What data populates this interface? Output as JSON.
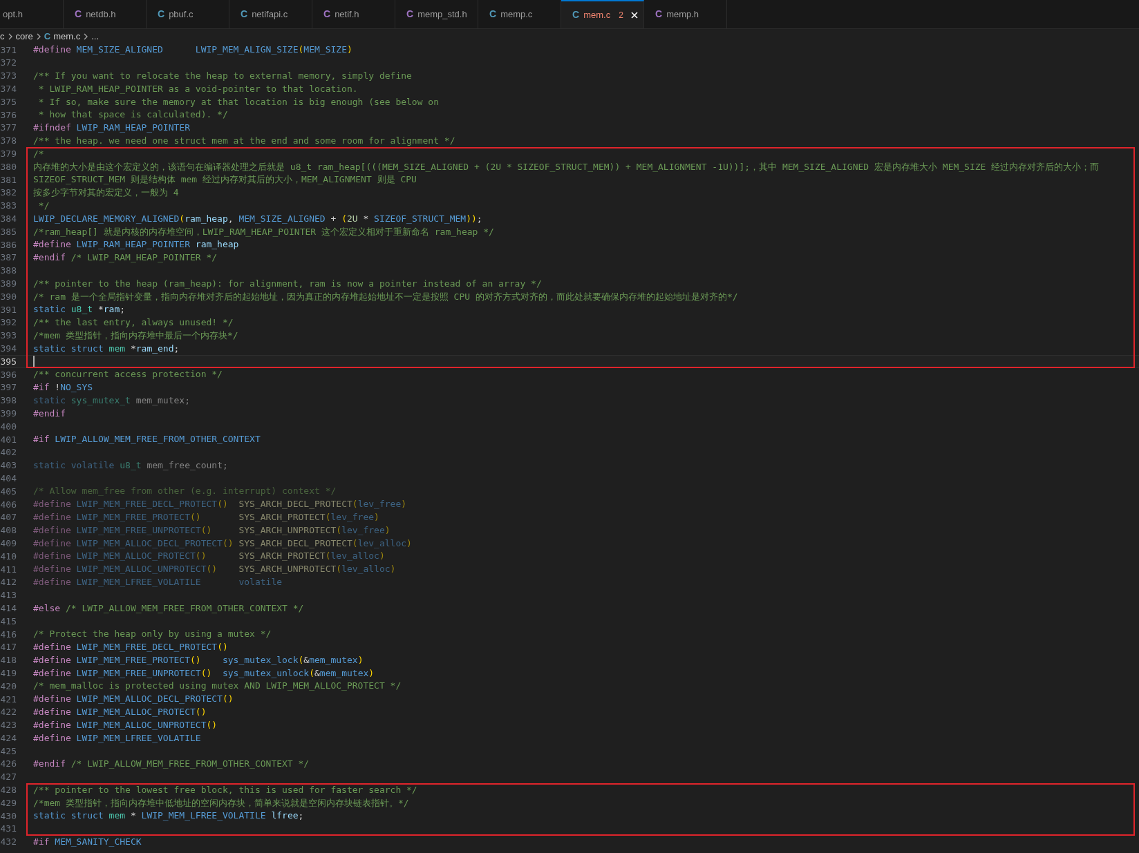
{
  "tabs": [
    {
      "label": "opt.h",
      "selected": false
    },
    {
      "icon": "C",
      "color": "#a074c4",
      "label": "netdb.h",
      "selected": false
    },
    {
      "icon": "C",
      "color": "#519aba",
      "label": "pbuf.c",
      "selected": false
    },
    {
      "icon": "C",
      "color": "#519aba",
      "label": "netifapi.c",
      "selected": false
    },
    {
      "icon": "C",
      "color": "#a074c4",
      "label": "netif.h",
      "selected": false
    },
    {
      "icon": "C",
      "color": "#a074c4",
      "label": "memp_std.h",
      "selected": false
    },
    {
      "icon": "C",
      "color": "#519aba",
      "label": "memp.c",
      "selected": false
    },
    {
      "icon": "C",
      "color": "#519aba",
      "label": "mem.c",
      "problems": "2",
      "selected": true
    },
    {
      "icon": "C",
      "color": "#a074c4",
      "label": "memp.h",
      "selected": false
    }
  ],
  "breadcrumb": [
    {
      "label": "c"
    },
    {
      "label": "core"
    },
    {
      "icon": "C",
      "label": "mem.c"
    },
    {
      "label": "..."
    }
  ],
  "editor": {
    "blocks": [
      {
        "highlighted": false,
        "lines": [
          {
            "number": "371",
            "inactive": false,
            "current": false,
            "tokens": [
              {
                "text": "#define",
                "kind": "pp"
              },
              {
                "text": " MEM_SIZE_ALIGNED",
                "kind": "mac"
              },
              {
                "text": "      LWIP_MEM_ALIGN_SIZE",
                "kind": "mac"
              },
              {
                "text": "(",
                "kind": "br"
              },
              {
                "text": "MEM_SIZE",
                "kind": "mac"
              },
              {
                "text": ")",
                "kind": "br"
              }
            ]
          },
          {
            "number": "372",
            "current": false
          },
          {
            "number": "373",
            "inactive": false,
            "current": false,
            "tokens": [
              {
                "text": "/** If you want to relocate the heap to external memory, simply define",
                "kind": "cm"
              }
            ]
          },
          {
            "number": "374",
            "inactive": false,
            "current": false,
            "tokens": [
              {
                "text": " * LWIP_RAM_HEAP_POINTER as a void-pointer to that location.",
                "kind": "cm"
              }
            ]
          },
          {
            "number": "375",
            "inactive": false,
            "current": false,
            "tokens": [
              {
                "text": " * If so, make sure the memory at that location is big enough (see below on",
                "kind": "cm"
              }
            ]
          },
          {
            "number": "376",
            "inactive": false,
            "current": false,
            "tokens": [
              {
                "text": " * how that space is calculated). */",
                "kind": "cm"
              }
            ]
          },
          {
            "number": "377",
            "inactive": false,
            "current": false,
            "tokens": [
              {
                "text": "#ifndef",
                "kind": "pp"
              },
              {
                "text": " LWIP_RAM_HEAP_POINTER",
                "kind": "mac"
              }
            ]
          },
          {
            "number": "378",
            "inactive": false,
            "current": false,
            "tokens": [
              {
                "text": "/** the heap. we need one struct mem at the end and some room for alignment */",
                "kind": "cm"
              }
            ]
          }
        ]
      },
      {
        "highlighted": true,
        "lines": [
          {
            "number": "379",
            "inactive": false,
            "current": false,
            "tokens": [
              {
                "text": "/*",
                "kind": "cm"
              }
            ]
          },
          {
            "number": "380",
            "inactive": false,
            "current": false,
            "tokens": [
              {
                "text": "内存堆的大小是由这个宏定义的，该语句在编译器处理之后就是 u8_t ram_heap[(((MEM_SIZE_ALIGNED + (2U * SIZEOF_STRUCT_MEM)) + MEM_ALIGNMENT -1U))];，其中 MEM_SIZE_ALIGNED 宏是内存堆大小 MEM_SIZE 经过内存对齐后的大小；而",
                "kind": "cm"
              }
            ]
          },
          {
            "number": "381",
            "inactive": false,
            "current": false,
            "tokens": [
              {
                "text": "SIZEOF_STRUCT_MEM 则是结构体 mem 经过内存对其后的大小，MEM_ALIGNMENT 则是 CPU",
                "kind": "cm"
              }
            ]
          },
          {
            "number": "382",
            "inactive": false,
            "current": false,
            "tokens": [
              {
                "text": "按多少字节对其的宏定义，一般为 4",
                "kind": "cm"
              }
            ]
          },
          {
            "number": "383",
            "inactive": false,
            "current": false,
            "tokens": [
              {
                "text": " */",
                "kind": "cm"
              }
            ]
          },
          {
            "number": "384",
            "inactive": false,
            "current": false,
            "tokens": [
              {
                "text": "LWIP_DECLARE_MEMORY_ALIGNED",
                "kind": "mac"
              },
              {
                "text": "(",
                "kind": "br"
              },
              {
                "text": "ram_heap",
                "kind": "var"
              },
              {
                "text": ",",
                "kind": "pl"
              },
              {
                "text": " MEM_SIZE_ALIGNED",
                "kind": "mac"
              },
              {
                "text": " +",
                "kind": "pl"
              },
              {
                "text": " (",
                "kind": "br"
              },
              {
                "text": "2U",
                "kind": "num"
              },
              {
                "text": " *",
                "kind": "pl"
              },
              {
                "text": " SIZEOF_STRUCT_MEM",
                "kind": "mac"
              },
              {
                "text": "))",
                "kind": "br"
              },
              {
                "text": ";",
                "kind": "pl"
              }
            ]
          },
          {
            "number": "385",
            "inactive": false,
            "current": false,
            "tokens": [
              {
                "text": "/*ram_heap[] 就是内核的内存堆空间，LWIP_RAM_HEAP_POINTER 这个宏定义相对于重新命名 ram_heap */",
                "kind": "cm"
              }
            ]
          },
          {
            "number": "386",
            "inactive": false,
            "current": false,
            "tokens": [
              {
                "text": "#define",
                "kind": "pp"
              },
              {
                "text": " LWIP_RAM_HEAP_POINTER",
                "kind": "mac"
              },
              {
                "text": " ram_heap",
                "kind": "var"
              }
            ]
          },
          {
            "number": "387",
            "inactive": false,
            "current": false,
            "tokens": [
              {
                "text": "#endif",
                "kind": "pp"
              },
              {
                "text": " /* LWIP_RAM_HEAP_POINTER */",
                "kind": "cm"
              }
            ]
          },
          {
            "number": "388",
            "current": false
          },
          {
            "number": "389",
            "inactive": false,
            "current": false,
            "tokens": [
              {
                "text": "/** pointer to the heap (ram_heap): for alignment, ram is now a pointer instead of an array */",
                "kind": "cm"
              }
            ]
          },
          {
            "number": "390",
            "inactive": false,
            "current": false,
            "tokens": [
              {
                "text": "/* ram 是一个全局指针变量，指向内存堆对齐后的起始地址，因为真正的内存堆起始地址不一定是按照 CPU 的对齐方式对齐的，而此处就要确保内存堆的起始地址是对齐的*/",
                "kind": "cm"
              }
            ]
          },
          {
            "number": "391",
            "inactive": false,
            "current": false,
            "tokens": [
              {
                "text": "static",
                "kind": "kw"
              },
              {
                "text": " u8_t",
                "kind": "ty"
              },
              {
                "text": " *",
                "kind": "pl"
              },
              {
                "text": "ram",
                "kind": "var"
              },
              {
                "text": ";",
                "kind": "pl"
              }
            ]
          },
          {
            "number": "392",
            "inactive": false,
            "current": false,
            "tokens": [
              {
                "text": "/** the last entry, always unused! */",
                "kind": "cm"
              }
            ]
          },
          {
            "number": "393",
            "inactive": false,
            "current": false,
            "tokens": [
              {
                "text": "/*mem 类型指针，指向内存堆中最后一个内存块*/",
                "kind": "cm"
              }
            ]
          },
          {
            "number": "394",
            "inactive": false,
            "current": false,
            "tokens": [
              {
                "text": "static",
                "kind": "kw"
              },
              {
                "text": " struct",
                "kind": "kw"
              },
              {
                "text": " mem",
                "kind": "ty"
              },
              {
                "text": " *",
                "kind": "pl"
              },
              {
                "text": "ram_end",
                "kind": "var"
              },
              {
                "text": ";",
                "kind": "pl"
              }
            ]
          },
          {
            "number": "395",
            "current": true
          }
        ]
      },
      {
        "highlighted": false,
        "lines": [
          {
            "number": "396",
            "inactive": false,
            "current": false,
            "tokens": [
              {
                "text": "/** concurrent access protection */",
                "kind": "cm"
              }
            ]
          },
          {
            "number": "397",
            "inactive": false,
            "current": false,
            "tokens": [
              {
                "text": "#if",
                "kind": "pp"
              },
              {
                "text": " !",
                "kind": "pl"
              },
              {
                "text": "NO_SYS",
                "kind": "mac"
              }
            ]
          },
          {
            "number": "398",
            "inactive": true,
            "current": false,
            "tokens": [
              {
                "text": "static",
                "kind": "kw"
              },
              {
                "text": " sys_mutex_t",
                "kind": "ty"
              },
              {
                "text": " mem_mutex;",
                "kind": "pl"
              }
            ]
          },
          {
            "number": "399",
            "inactive": false,
            "current": false,
            "tokens": [
              {
                "text": "#endif",
                "kind": "pp"
              }
            ]
          },
          {
            "number": "400",
            "current": false
          },
          {
            "number": "401",
            "inactive": false,
            "current": false,
            "tokens": [
              {
                "text": "#if",
                "kind": "pp"
              },
              {
                "text": " LWIP_ALLOW_MEM_FREE_FROM_OTHER_CONTEXT",
                "kind": "mac"
              }
            ]
          },
          {
            "number": "402",
            "current": false
          },
          {
            "number": "403",
            "inactive": true,
            "current": false,
            "tokens": [
              {
                "text": "static",
                "kind": "kw"
              },
              {
                "text": " volatile",
                "kind": "kw"
              },
              {
                "text": " u8_t",
                "kind": "ty"
              },
              {
                "text": " mem_free_count;",
                "kind": "pl"
              }
            ]
          },
          {
            "number": "404",
            "current": false
          },
          {
            "number": "405",
            "inactive": true,
            "current": false,
            "tokens": [
              {
                "text": "/* Allow mem_free from other (e.g. interrupt) context */",
                "kind": "cm"
              }
            ]
          },
          {
            "number": "406",
            "inactive": true,
            "current": false,
            "tokens": [
              {
                "text": "#define",
                "kind": "pp"
              },
              {
                "text": " LWIP_MEM_FREE_DECL_PROTECT",
                "kind": "mac"
              },
              {
                "text": "()",
                "kind": "br"
              },
              {
                "text": "  SYS_ARCH_DECL_PROTECT",
                "kind": "fn"
              },
              {
                "text": "(",
                "kind": "br"
              },
              {
                "text": "lev_free",
                "kind": "mac"
              },
              {
                "text": ")",
                "kind": "br"
              }
            ]
          },
          {
            "number": "407",
            "inactive": true,
            "current": false,
            "tokens": [
              {
                "text": "#define",
                "kind": "pp"
              },
              {
                "text": " LWIP_MEM_FREE_PROTECT",
                "kind": "mac"
              },
              {
                "text": "()",
                "kind": "br"
              },
              {
                "text": "       SYS_ARCH_PROTECT",
                "kind": "fn"
              },
              {
                "text": "(",
                "kind": "br"
              },
              {
                "text": "lev_free",
                "kind": "mac"
              },
              {
                "text": ")",
                "kind": "br"
              }
            ]
          },
          {
            "number": "408",
            "inactive": true,
            "current": false,
            "tokens": [
              {
                "text": "#define",
                "kind": "pp"
              },
              {
                "text": " LWIP_MEM_FREE_UNPROTECT",
                "kind": "mac"
              },
              {
                "text": "()",
                "kind": "br"
              },
              {
                "text": "     SYS_ARCH_UNPROTECT",
                "kind": "fn"
              },
              {
                "text": "(",
                "kind": "br"
              },
              {
                "text": "lev_free",
                "kind": "mac"
              },
              {
                "text": ")",
                "kind": "br"
              }
            ]
          },
          {
            "number": "409",
            "inactive": true,
            "current": false,
            "tokens": [
              {
                "text": "#define",
                "kind": "pp"
              },
              {
                "text": " LWIP_MEM_ALLOC_DECL_PROTECT",
                "kind": "mac"
              },
              {
                "text": "()",
                "kind": "br"
              },
              {
                "text": " SYS_ARCH_DECL_PROTECT",
                "kind": "fn"
              },
              {
                "text": "(",
                "kind": "br"
              },
              {
                "text": "lev_alloc",
                "kind": "mac"
              },
              {
                "text": ")",
                "kind": "br"
              }
            ]
          },
          {
            "number": "410",
            "inactive": true,
            "current": false,
            "tokens": [
              {
                "text": "#define",
                "kind": "pp"
              },
              {
                "text": " LWIP_MEM_ALLOC_PROTECT",
                "kind": "mac"
              },
              {
                "text": "()",
                "kind": "br"
              },
              {
                "text": "      SYS_ARCH_PROTECT",
                "kind": "fn"
              },
              {
                "text": "(",
                "kind": "br"
              },
              {
                "text": "lev_alloc",
                "kind": "mac"
              },
              {
                "text": ")",
                "kind": "br"
              }
            ]
          },
          {
            "number": "411",
            "inactive": true,
            "current": false,
            "tokens": [
              {
                "text": "#define",
                "kind": "pp"
              },
              {
                "text": " LWIP_MEM_ALLOC_UNPROTECT",
                "kind": "mac"
              },
              {
                "text": "()",
                "kind": "br"
              },
              {
                "text": "    SYS_ARCH_UNPROTECT",
                "kind": "fn"
              },
              {
                "text": "(",
                "kind": "br"
              },
              {
                "text": "lev_alloc",
                "kind": "mac"
              },
              {
                "text": ")",
                "kind": "br"
              }
            ]
          },
          {
            "number": "412",
            "inactive": true,
            "current": false,
            "tokens": [
              {
                "text": "#define",
                "kind": "pp"
              },
              {
                "text": " LWIP_MEM_LFREE_VOLATILE",
                "kind": "mac"
              },
              {
                "text": "       volatile",
                "kind": "kw"
              }
            ]
          },
          {
            "number": "413",
            "current": false
          },
          {
            "number": "414",
            "inactive": false,
            "current": false,
            "tokens": [
              {
                "text": "#else",
                "kind": "pp"
              },
              {
                "text": " /* LWIP_ALLOW_MEM_FREE_FROM_OTHER_CONTEXT */",
                "kind": "cm"
              }
            ]
          },
          {
            "number": "415",
            "current": false
          },
          {
            "number": "416",
            "inactive": false,
            "current": false,
            "tokens": [
              {
                "text": "/* Protect the heap only by using a mutex */",
                "kind": "cm"
              }
            ]
          },
          {
            "number": "417",
            "inactive": false,
            "current": false,
            "tokens": [
              {
                "text": "#define",
                "kind": "pp"
              },
              {
                "text": " LWIP_MEM_FREE_DECL_PROTECT",
                "kind": "mac"
              },
              {
                "text": "()",
                "kind": "br"
              }
            ]
          },
          {
            "number": "418",
            "inactive": false,
            "current": false,
            "tokens": [
              {
                "text": "#define",
                "kind": "pp"
              },
              {
                "text": " LWIP_MEM_FREE_PROTECT",
                "kind": "mac"
              },
              {
                "text": "()",
                "kind": "br"
              },
              {
                "text": "    sys_mutex_lock",
                "kind": "mac"
              },
              {
                "text": "(",
                "kind": "br"
              },
              {
                "text": "&",
                "kind": "pl"
              },
              {
                "text": "mem_mutex",
                "kind": "mac"
              },
              {
                "text": ")",
                "kind": "br"
              }
            ]
          },
          {
            "number": "419",
            "inactive": false,
            "current": false,
            "tokens": [
              {
                "text": "#define",
                "kind": "pp"
              },
              {
                "text": " LWIP_MEM_FREE_UNPROTECT",
                "kind": "mac"
              },
              {
                "text": "()",
                "kind": "br"
              },
              {
                "text": "  sys_mutex_unlock",
                "kind": "mac"
              },
              {
                "text": "(",
                "kind": "br"
              },
              {
                "text": "&",
                "kind": "pl"
              },
              {
                "text": "mem_mutex",
                "kind": "mac"
              },
              {
                "text": ")",
                "kind": "br"
              }
            ]
          },
          {
            "number": "420",
            "inactive": false,
            "current": false,
            "tokens": [
              {
                "text": "/* mem_malloc is protected using mutex AND LWIP_MEM_ALLOC_PROTECT */",
                "kind": "cm"
              }
            ]
          },
          {
            "number": "421",
            "inactive": false,
            "current": false,
            "tokens": [
              {
                "text": "#define",
                "kind": "pp"
              },
              {
                "text": " LWIP_MEM_ALLOC_DECL_PROTECT",
                "kind": "mac"
              },
              {
                "text": "()",
                "kind": "br"
              }
            ]
          },
          {
            "number": "422",
            "inactive": false,
            "current": false,
            "tokens": [
              {
                "text": "#define",
                "kind": "pp"
              },
              {
                "text": " LWIP_MEM_ALLOC_PROTECT",
                "kind": "mac"
              },
              {
                "text": "()",
                "kind": "br"
              }
            ]
          },
          {
            "number": "423",
            "inactive": false,
            "current": false,
            "tokens": [
              {
                "text": "#define",
                "kind": "pp"
              },
              {
                "text": " LWIP_MEM_ALLOC_UNPROTECT",
                "kind": "mac"
              },
              {
                "text": "()",
                "kind": "br"
              }
            ]
          },
          {
            "number": "424",
            "inactive": false,
            "current": false,
            "tokens": [
              {
                "text": "#define",
                "kind": "pp"
              },
              {
                "text": " LWIP_MEM_LFREE_VOLATILE",
                "kind": "mac"
              }
            ]
          },
          {
            "number": "425",
            "current": false
          },
          {
            "number": "426",
            "inactive": false,
            "current": false,
            "tokens": [
              {
                "text": "#endif",
                "kind": "pp"
              },
              {
                "text": " /* LWIP_ALLOW_MEM_FREE_FROM_OTHER_CONTEXT */",
                "kind": "cm"
              }
            ]
          },
          {
            "number": "427",
            "current": false
          }
        ]
      },
      {
        "highlighted": true,
        "lines": [
          {
            "number": "428",
            "inactive": false,
            "current": false,
            "tokens": [
              {
                "text": "/** pointer to the lowest free block, this is used for faster search */",
                "kind": "cm"
              }
            ]
          },
          {
            "number": "429",
            "inactive": false,
            "current": false,
            "tokens": [
              {
                "text": "/*mem 类型指针，指向内存堆中低地址的空闲内存块，简单来说就是空闲内存块链表指针。*/",
                "kind": "cm"
              }
            ]
          },
          {
            "number": "430",
            "inactive": false,
            "current": false,
            "tokens": [
              {
                "text": "static",
                "kind": "kw"
              },
              {
                "text": " struct",
                "kind": "kw"
              },
              {
                "text": " mem",
                "kind": "ty"
              },
              {
                "text": " *",
                "kind": "pl"
              },
              {
                "text": " LWIP_MEM_LFREE_VOLATILE",
                "kind": "mac"
              },
              {
                "text": " lfree",
                "kind": "var"
              },
              {
                "text": ";",
                "kind": "pl"
              }
            ]
          },
          {
            "number": "431",
            "current": false
          }
        ]
      },
      {
        "highlighted": false,
        "lines": [
          {
            "number": "432",
            "inactive": false,
            "current": false,
            "tokens": [
              {
                "text": "#if",
                "kind": "pp"
              },
              {
                "text": " MEM_SANITY_CHECK",
                "kind": "mac"
              }
            ]
          }
        ]
      }
    ]
  }
}
